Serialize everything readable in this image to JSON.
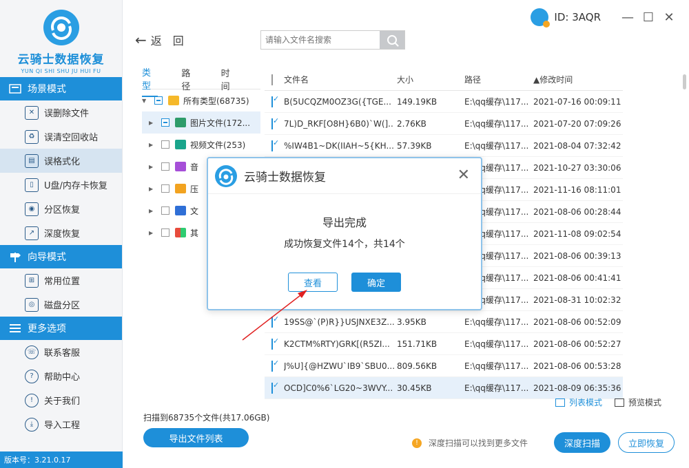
{
  "app": {
    "title": "云骑士数据恢复",
    "subtitle": "YUN QI SHI SHU JU HUI FU",
    "version": "版本号：3.21.0.17"
  },
  "topbar": {
    "user_id": "ID: 3AQR",
    "minimize": "—",
    "maximize": "☐",
    "close": "✕"
  },
  "nav": {
    "back_arrow": "←",
    "back_label": "返　回"
  },
  "search": {
    "placeholder": "请输入文件名搜索"
  },
  "sidebar": {
    "sections": [
      {
        "label": "场景模式",
        "items": [
          "误删除文件",
          "误清空回收站",
          "误格式化",
          "U盘/内存卡恢复",
          "分区恢复",
          "深度恢复"
        ]
      },
      {
        "label": "向导模式",
        "items": [
          "常用位置",
          "磁盘分区"
        ]
      },
      {
        "label": "更多选项",
        "items": [
          "联系客服",
          "帮助中心",
          "关于我们",
          "导入工程"
        ]
      }
    ]
  },
  "tree": {
    "tabs": [
      "类型",
      "路径",
      "时间"
    ],
    "rows": [
      {
        "label": "所有类型(68735)"
      },
      {
        "label": "图片文件(172..."
      },
      {
        "label": "视频文件(253)"
      },
      {
        "label": "音"
      },
      {
        "label": "压"
      },
      {
        "label": "文"
      },
      {
        "label": "其"
      }
    ]
  },
  "table": {
    "headers": {
      "name": "文件名",
      "size": "大小",
      "path": "路径",
      "time": "▲修改时间"
    },
    "rows": [
      {
        "name": "B(5UCQZM0OZ3G({TGE...",
        "size": "149.19KB",
        "path": "E:\\qq缓存\\117...",
        "time": "2021-07-16 00:09:11"
      },
      {
        "name": "7L)D_RKF[O8H}6B0)`W(]...",
        "size": "2.76KB",
        "path": "E:\\qq缓存\\117...",
        "time": "2021-07-20 07:09:26"
      },
      {
        "name": "%IW4B1~DK(IIAH~5{KH...",
        "size": "57.39KB",
        "path": "E:\\qq缓存\\117...",
        "time": "2021-08-04 07:32:42"
      },
      {
        "name": "",
        "size": "",
        "path": "E:\\qq缓存\\117...",
        "time": "2021-10-27 03:30:06"
      },
      {
        "name": "",
        "size": "",
        "path": "E:\\qq缓存\\117...",
        "time": "2021-11-16 08:11:01"
      },
      {
        "name": "",
        "size": "",
        "path": "E:\\qq缓存\\117...",
        "time": "2021-08-06 00:28:44"
      },
      {
        "name": "",
        "size": "",
        "path": "E:\\qq缓存\\117...",
        "time": "2021-11-08 09:02:54"
      },
      {
        "name": "",
        "size": "",
        "path": "E:\\qq缓存\\117...",
        "time": "2021-08-06 00:39:13"
      },
      {
        "name": "",
        "size": "",
        "path": "E:\\qq缓存\\117...",
        "time": "2021-08-06 00:41:41"
      },
      {
        "name": "",
        "size": "",
        "path": "E:\\qq缓存\\117...",
        "time": "2021-08-31 10:02:32"
      },
      {
        "name": "19SS@`(P)R}}USJNXE3Z...",
        "size": "3.95KB",
        "path": "E:\\qq缓存\\117...",
        "time": "2021-08-06 00:52:09"
      },
      {
        "name": "K2CTM%RTY)GRK[(R5ZI...",
        "size": "151.71KB",
        "path": "E:\\qq缓存\\117...",
        "time": "2021-08-06 00:52:27"
      },
      {
        "name": "J%U]{@HZWU`IB9`SBU0...",
        "size": "809.56KB",
        "path": "E:\\qq缓存\\117...",
        "time": "2021-08-06 00:53:28"
      },
      {
        "name": "OCD]C0%6`LG20~3WVY...",
        "size": "30.45KB",
        "path": "E:\\qq缓存\\117...",
        "time": "2021-08-09 06:35:36"
      }
    ]
  },
  "view_modes": {
    "list": "列表模式",
    "preview": "预览模式"
  },
  "bottom": {
    "scan_info": "扫描到68735个文件(共17.06GB)",
    "export_button": "导出文件列表",
    "hint": "深度扫描可以找到更多文件",
    "deep_scan": "深度扫描",
    "recover_now": "立即恢复"
  },
  "dialog": {
    "title": "云骑士数据恢复",
    "close": "✕",
    "message": "导出完成",
    "detail": "成功恢复文件14个，共14个",
    "view_button": "查看",
    "ok_button": "确定"
  },
  "colors": {
    "accent": "#1e8fd9",
    "warning": "#f5a623",
    "annotation_arrow": "#e02020"
  }
}
